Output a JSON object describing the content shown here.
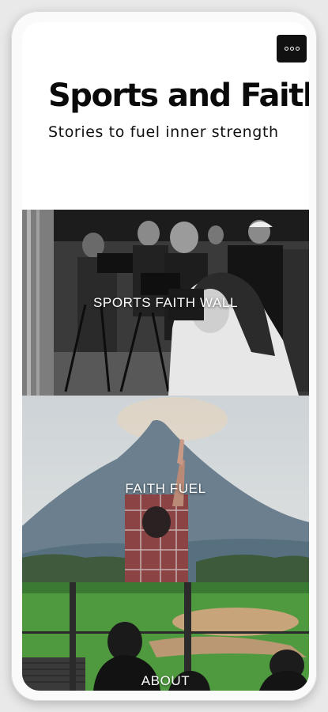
{
  "header": {
    "title": "Sports and Faith",
    "subtitle": "Stories to fuel inner strength",
    "menu_icon": "more-dots-icon"
  },
  "tiles": [
    {
      "label": "SPORTS FAITH WALL",
      "image": "photographers-at-game-photo"
    },
    {
      "label": "FAITH FUEL",
      "image": "man-pointing-at-mountain-photo"
    },
    {
      "label": "ABOUT",
      "image": "baseball-stadium-view-photo"
    }
  ],
  "colors": {
    "background": "#e9e9e9",
    "screen": "#ffffff",
    "title_text": "#0a0a0a",
    "menu_button": "#111111",
    "tile_label": "#ffffff"
  }
}
